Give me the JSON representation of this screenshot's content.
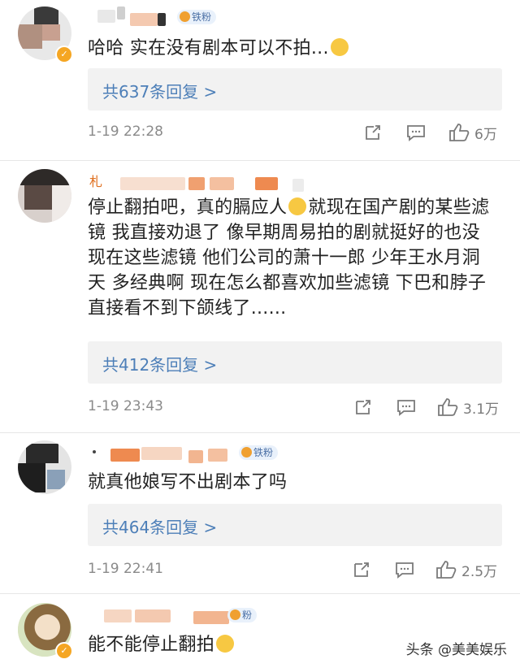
{
  "comments": [
    {
      "text": "哈哈 实在没有剧本可以不拍...",
      "fan_label": "铁粉",
      "replies": "共637条回复 >",
      "time": "1-19 22:28",
      "likes": "6万"
    },
    {
      "name_initial": "札",
      "text": "停止翻拍吧，真的膈应人",
      "text_rest": "就现在国产剧的某些滤镜 我直接劝退了 像早期周易拍的剧就挺好的也没现在这些滤镜 他们公司的萧十一郎 少年王水月洞天 多经典啊 现在怎么都喜欢加些滤镜 下巴和脖子直接看不到下颌线了......",
      "replies": "共412条回复 >",
      "time": "1-19 23:43",
      "likes": "3.1万"
    },
    {
      "text": "就真他娘写不出剧本了吗",
      "fan_label": "铁粉",
      "replies": "共464条回复 >",
      "time": "1-19 22:41",
      "likes": "2.5万"
    },
    {
      "text": "能不能停止翻拍",
      "fan_label": "粉"
    }
  ],
  "watermark": "头条 @美美娱乐",
  "icons": [
    "share-icon",
    "comment-icon",
    "like-icon",
    "verified-icon"
  ],
  "colors": {
    "link": "#4d7fb8",
    "reply_bg": "#f2f2f2",
    "meta": "#8a8a8a"
  }
}
